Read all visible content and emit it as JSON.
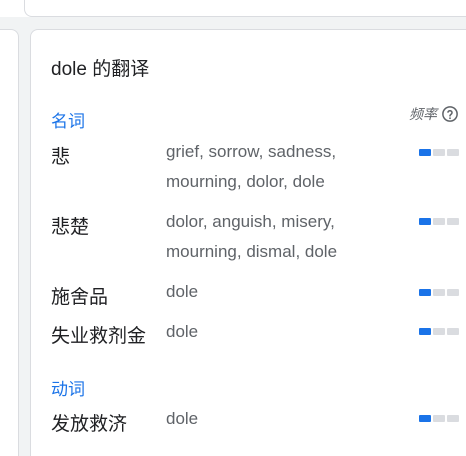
{
  "card": {
    "title": "dole 的翻译",
    "frequency_label": "频率",
    "help_icon": "question-circle-icon"
  },
  "colors": {
    "accent": "#1a73e8",
    "bar_off": "#dadce0",
    "text_primary": "#202124",
    "text_secondary": "#5f6368"
  },
  "sections": [
    {
      "pos": "名词",
      "entries": [
        {
          "term": "悲",
          "translations": "grief, sorrow, sadness, mourning, dolor, dole",
          "frequency": 1,
          "frequency_max": 3
        },
        {
          "term": "悲楚",
          "translations": "dolor, anguish, misery, mourning, dismal, dole",
          "frequency": 1,
          "frequency_max": 3
        },
        {
          "term": "施舍品",
          "translations": "dole",
          "frequency": 1,
          "frequency_max": 3
        },
        {
          "term": "失业救剂金",
          "translations": "dole",
          "frequency": 1,
          "frequency_max": 3
        }
      ]
    },
    {
      "pos": "动词",
      "entries": [
        {
          "term": "发放救济",
          "translations": "dole",
          "frequency": 1,
          "frequency_max": 3
        }
      ]
    }
  ]
}
